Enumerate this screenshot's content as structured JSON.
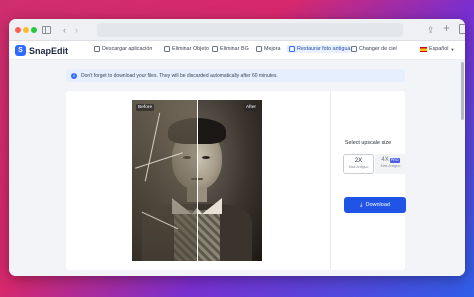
{
  "nav": {
    "brand": "SnapEdit",
    "items": [
      {
        "label": "Descargar aplicación"
      },
      {
        "label": "Eliminar Objeto"
      },
      {
        "label": "Eliminar BG"
      },
      {
        "label": "Mejora"
      },
      {
        "label": "Restaurar foto antigua"
      },
      {
        "label": "Changer de ciel"
      }
    ],
    "active_index": 4,
    "language": "Español"
  },
  "notice": {
    "text": "Don't forget to download your files. They will be discarded automatically after 60 minutes."
  },
  "compare": {
    "before_label": "Before",
    "after_label": "After"
  },
  "upscale": {
    "title": "Select upscale size",
    "options": [
      {
        "label": "2X",
        "sub": "Mas Antiguo"
      },
      {
        "label": "4X",
        "badge": "PRO",
        "sub": "Mas Antiguo"
      }
    ],
    "selected": "2X"
  },
  "download_label": "Download",
  "colors": {
    "accent": "#1f54e6",
    "notice_bg": "#e6effd",
    "page_bg": "#f2f4f8"
  },
  "icons": [
    "sidebar-icon",
    "back-arrow-icon",
    "forward-arrow-icon",
    "share-icon",
    "plus-icon",
    "tabs-icon",
    "info-icon",
    "download-icon",
    "spain-flag-icon"
  ]
}
